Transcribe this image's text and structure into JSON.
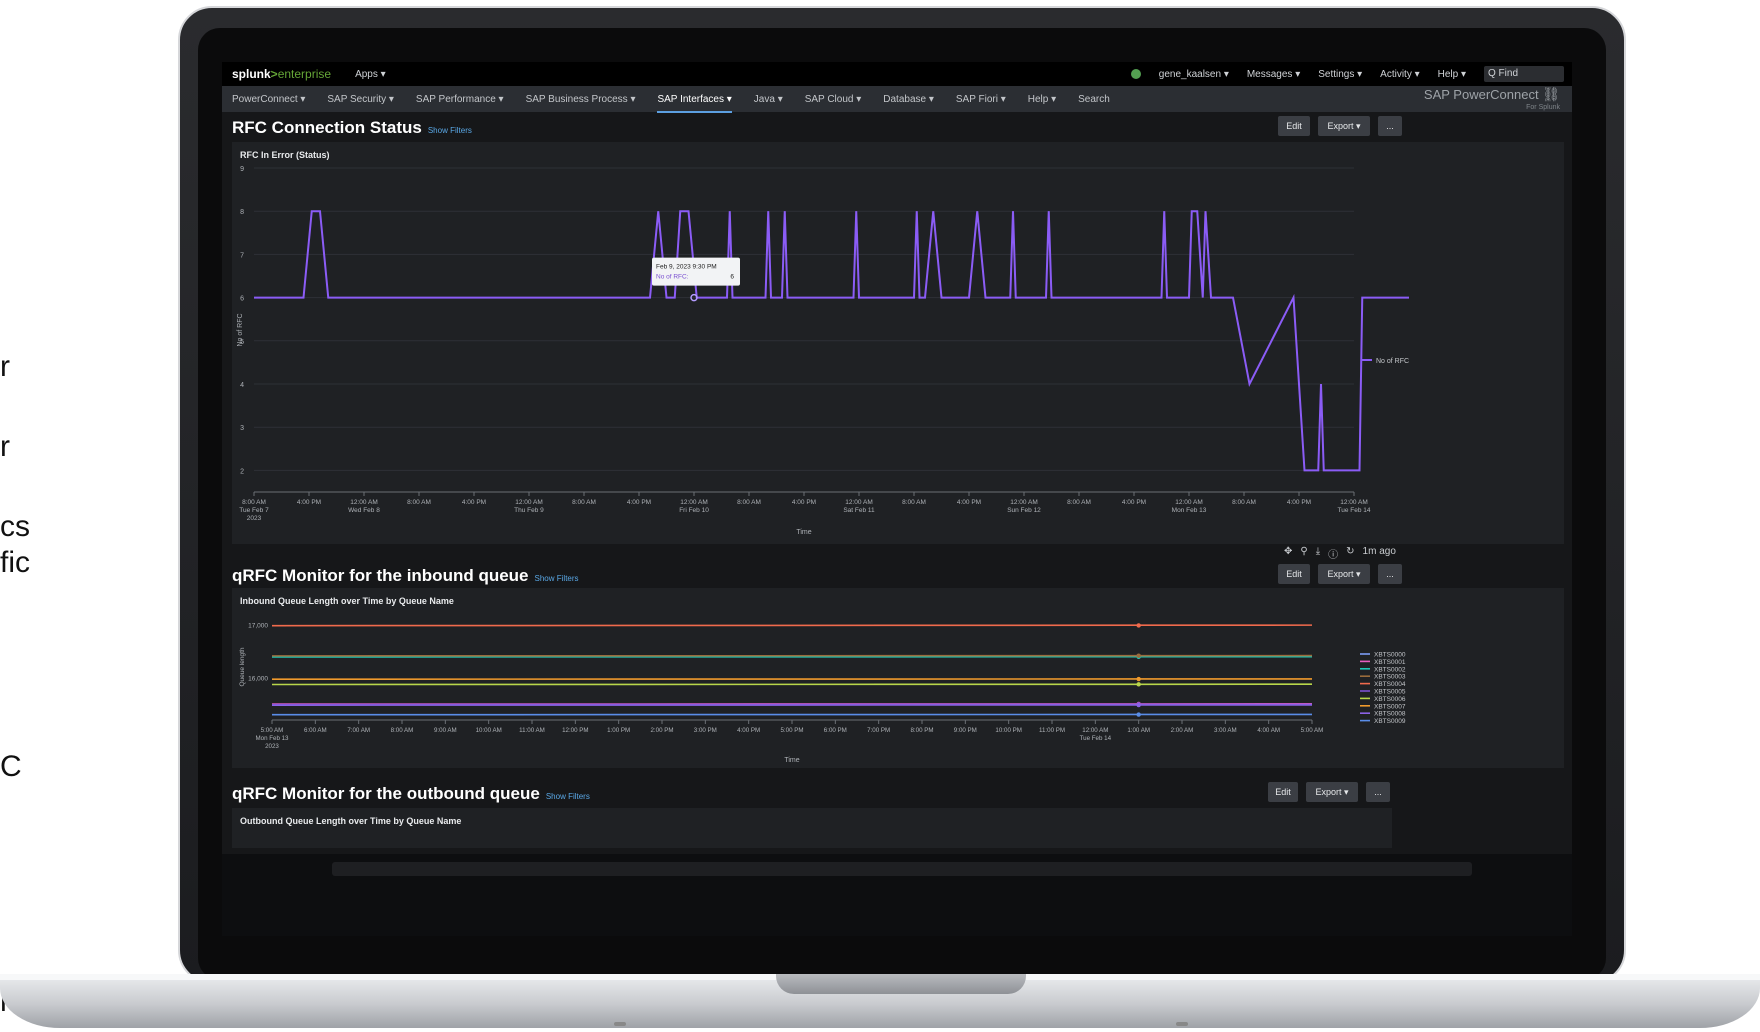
{
  "side_fragments": [
    "r",
    "r",
    "cs",
    "fic",
    "C",
    "n"
  ],
  "topbar": {
    "logo_main": "splunk",
    "logo_sep": ">",
    "logo_edition": "enterprise",
    "apps": "Apps ▾",
    "user": "gene_kaalsen ▾",
    "messages": "Messages ▾",
    "settings": "Settings ▾",
    "activity": "Activity ▾",
    "help": "Help ▾",
    "find_placeholder": "Q Find"
  },
  "nav": {
    "items": [
      "PowerConnect ▾",
      "SAP Security ▾",
      "SAP Performance ▾",
      "SAP Business Process ▾",
      "SAP Interfaces ▾",
      "Java ▾",
      "SAP Cloud ▾",
      "Database ▾",
      "SAP Fiori ▾",
      "Help ▾",
      "Search"
    ],
    "active_index": 4,
    "brand_title": "SAP PowerConnect",
    "brand_sub": "For Splunk"
  },
  "panels": [
    {
      "title": "RFC Connection Status",
      "show_filters": "Show Filters",
      "edit": "Edit",
      "export": "Export ▾",
      "more": "..."
    },
    {
      "title": "qRFC Monitor for the inbound queue",
      "show_filters": "Show Filters",
      "edit": "Edit",
      "export": "Export ▾",
      "more": "..."
    },
    {
      "title": "qRFC Monitor for the outbound queue",
      "show_filters": "Show Filters",
      "edit": "Edit",
      "export": "Export ▾",
      "more": "..."
    }
  ],
  "chart_tools": {
    "time_ago": "1m ago"
  },
  "chart_data": [
    {
      "type": "line",
      "title": "RFC In Error (Status)",
      "xlabel": "Time",
      "ylabel": "No of RFC",
      "ylim": [
        1.5,
        9
      ],
      "yticks": [
        2,
        3,
        4,
        5,
        6,
        7,
        8,
        9
      ],
      "xtick_labels": [
        [
          "8:00 AM",
          "Tue Feb 7",
          "2023"
        ],
        [
          "4:00 PM"
        ],
        [
          "12:00 AM",
          "Wed Feb 8"
        ],
        [
          "8:00 AM"
        ],
        [
          "4:00 PM"
        ],
        [
          "12:00 AM",
          "Thu Feb 9"
        ],
        [
          "8:00 AM"
        ],
        [
          "4:00 PM"
        ],
        [
          "12:00 AM",
          "Fri Feb 10"
        ],
        [
          "8:00 AM"
        ],
        [
          "4:00 PM"
        ],
        [
          "12:00 AM",
          "Sat Feb 11"
        ],
        [
          "8:00 AM"
        ],
        [
          "4:00 PM"
        ],
        [
          "12:00 AM",
          "Sun Feb 12"
        ],
        [
          "8:00 AM"
        ],
        [
          "4:00 PM"
        ],
        [
          "12:00 AM",
          "Mon Feb 13"
        ],
        [
          "8:00 AM"
        ],
        [
          "4:00 PM"
        ],
        [
          "12:00 AM",
          "Tue Feb 14"
        ]
      ],
      "series": [
        {
          "name": "No of RFC",
          "color": "#8b5cf6",
          "x": [
            0,
            0.9,
            1.05,
            1.2,
            1.35,
            7.2,
            7.35,
            7.5,
            7.65,
            7.75,
            7.9,
            8.05,
            8.2,
            8.6,
            8.65,
            8.7,
            9.3,
            9.35,
            9.4,
            9.6,
            9.65,
            9.7,
            10.9,
            10.95,
            11.0,
            12.0,
            12.05,
            12.1,
            12.2,
            12.35,
            12.5,
            13.0,
            13.15,
            13.3,
            13.75,
            13.8,
            13.85,
            14.4,
            14.45,
            14.5,
            16.5,
            16.55,
            16.6,
            17.0,
            17.05,
            17.15,
            17.25,
            17.3,
            17.4,
            17.8,
            18.1,
            18.9,
            19.1,
            19.35,
            19.4,
            19.45,
            19.6,
            19.65,
            20.1,
            20.15,
            20.4,
            21.0
          ],
          "y": [
            6,
            6,
            8,
            8,
            6,
            6,
            8,
            6,
            6,
            8,
            8,
            6,
            6,
            6,
            8,
            6,
            6,
            8,
            6,
            6,
            8,
            6,
            6,
            8,
            6,
            6,
            8,
            6,
            6,
            8,
            6,
            6,
            8,
            6,
            6,
            8,
            6,
            6,
            8,
            6,
            6,
            8,
            6,
            6,
            8,
            8,
            6,
            8,
            6,
            6,
            4,
            6,
            2,
            2,
            4,
            2,
            2,
            2,
            2,
            6,
            6,
            6
          ]
        }
      ],
      "tooltip": {
        "line1": "Feb 9, 2023 9:30 PM",
        "label": "No of RFC:",
        "value": "6"
      },
      "legend": "right"
    },
    {
      "type": "line",
      "title": "Inbound Queue Length over Time by Queue Name",
      "xlabel": "Time",
      "ylabel": "Queue length",
      "yticks": [
        16000,
        17000
      ],
      "ytick_labels": [
        "16,000",
        "17,000"
      ],
      "ylim": [
        15200,
        17200
      ],
      "xtick_labels": [
        [
          "5:00 AM",
          "Mon Feb 13",
          "2023"
        ],
        [
          "6:00 AM"
        ],
        [
          "7:00 AM"
        ],
        [
          "8:00 AM"
        ],
        [
          "9:00 AM"
        ],
        [
          "10:00 AM"
        ],
        [
          "11:00 AM"
        ],
        [
          "12:00 PM"
        ],
        [
          "1:00 PM"
        ],
        [
          "2:00 PM"
        ],
        [
          "3:00 PM"
        ],
        [
          "4:00 PM"
        ],
        [
          "5:00 PM"
        ],
        [
          "6:00 PM"
        ],
        [
          "7:00 PM"
        ],
        [
          "8:00 PM"
        ],
        [
          "9:00 PM"
        ],
        [
          "10:00 PM"
        ],
        [
          "11:00 PM"
        ],
        [
          "12:00 AM",
          "Tue Feb 14"
        ],
        [
          "1:00 AM"
        ],
        [
          "2:00 AM"
        ],
        [
          "3:00 AM"
        ],
        [
          "4:00 AM"
        ],
        [
          "5:00 AM"
        ]
      ],
      "series": [
        {
          "name": "XBTS0000",
          "color": "#7c9cf5",
          "values": [
            16400,
            16405
          ]
        },
        {
          "name": "XBTS0001",
          "color": "#e85fbf",
          "values": [
            15500,
            15505
          ]
        },
        {
          "name": "XBTS0002",
          "color": "#1fc7b6",
          "values": [
            16390,
            16395
          ]
        },
        {
          "name": "XBTS0003",
          "color": "#9a6c3c",
          "values": [
            16410,
            16415
          ]
        },
        {
          "name": "XBTS0004",
          "color": "#f06a4c",
          "values": [
            16980,
            16990
          ]
        },
        {
          "name": "XBTS0005",
          "color": "#7a4fd1",
          "values": [
            15490,
            15495
          ]
        },
        {
          "name": "XBTS0006",
          "color": "#b8d64a",
          "values": [
            15870,
            15875
          ]
        },
        {
          "name": "XBTS0007",
          "color": "#f09a2c",
          "values": [
            15970,
            15975
          ]
        },
        {
          "name": "XBTS0008",
          "color": "#8b62e8",
          "values": [
            15480,
            15485
          ]
        },
        {
          "name": "XBTS0009",
          "color": "#5a8de8",
          "values": [
            15300,
            15305
          ]
        }
      ],
      "legend": "right"
    },
    {
      "type": "line",
      "title": "Outbound Queue Length over Time by Queue Name"
    }
  ]
}
